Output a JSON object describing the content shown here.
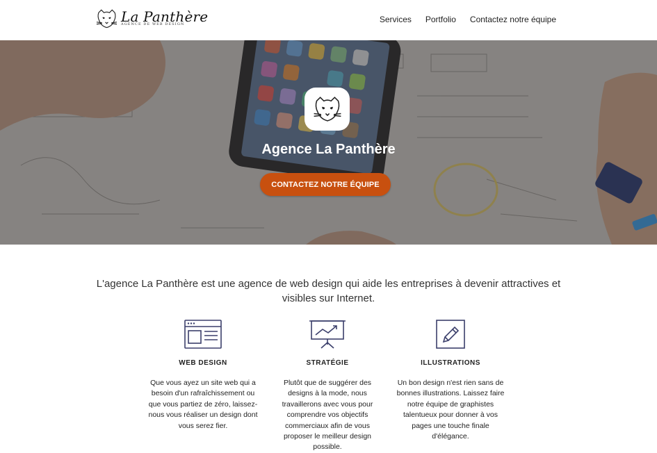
{
  "header": {
    "logo_name": "La Panthère",
    "logo_tagline": "AGENCE DE WEB DESIGN",
    "nav": [
      "Services",
      "Portfolio",
      "Contactez notre équipe"
    ]
  },
  "hero": {
    "title": "Agence La Panthère",
    "cta_label": "CONTACTEZ NOTRE ÉQUIPE"
  },
  "intro": {
    "text": "L'agence La Panthère est une agence de web design qui aide les entreprises à devenir attractives et visibles sur Internet."
  },
  "services": [
    {
      "icon": "browser-window-icon",
      "title": "WEB DESIGN",
      "text": "Que vous ayez un site web qui a besoin d'un rafraîchissement ou que vous partiez de zéro, laissez-nous vous réaliser un design dont vous serez fier."
    },
    {
      "icon": "presentation-chart-icon",
      "title": "STRATÉGIE",
      "text": "Plutôt que de suggérer des designs à la mode, nous travaillerons avec vous pour comprendre vos objectifs commerciaux afin de vous proposer le meilleur design possible."
    },
    {
      "icon": "pencil-box-icon",
      "title": "ILLUSTRATIONS",
      "text": "Un bon design n'est rien sans de bonnes illustrations. Laissez faire notre équipe de graphistes talentueux pour donner à vos pages une touche finale d'élégance."
    }
  ],
  "colors": {
    "accent": "#c8500f",
    "icon_stroke": "#3b3f6b"
  }
}
